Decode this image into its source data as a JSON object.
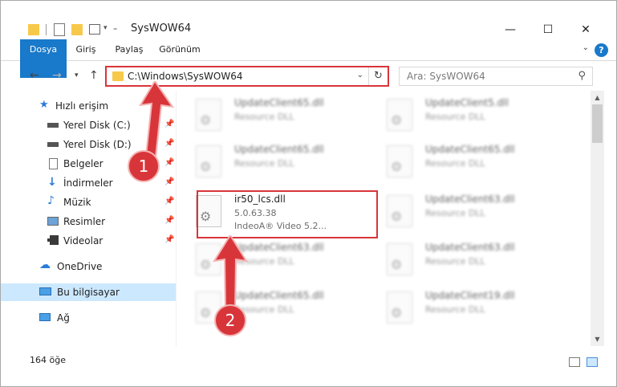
{
  "window": {
    "title": "SysWOW64",
    "controls": {
      "minimize": "—",
      "maximize": "☐",
      "close": "✕"
    }
  },
  "ribbon": {
    "tabs": [
      "Dosya",
      "Giriş",
      "Paylaş",
      "Görünüm"
    ],
    "help": "?"
  },
  "address": {
    "path": "C:\\Windows\\SysWOW64",
    "search_placeholder": "Ara: SysWOW64"
  },
  "sidebar": {
    "quick_access": "Hızlı erişim",
    "items": [
      {
        "label": "Yerel Disk (C:)",
        "icon": "drive-icon"
      },
      {
        "label": "Yerel Disk (D:)",
        "icon": "drive-icon"
      },
      {
        "label": "Belgeler",
        "icon": "documents-icon"
      },
      {
        "label": "İndirmeler",
        "icon": "downloads-icon"
      },
      {
        "label": "Müzik",
        "icon": "music-icon"
      },
      {
        "label": "Resimler",
        "icon": "pictures-icon"
      },
      {
        "label": "Videolar",
        "icon": "videos-icon"
      }
    ],
    "onedrive": "OneDrive",
    "this_pc": "Bu bilgisayar",
    "network": "Ağ"
  },
  "files": {
    "left_column": [
      {
        "name": "UpdateClient65.dll",
        "type": "Resource DLL",
        "blurred": true
      },
      {
        "name": "UpdateClient65.dll",
        "type": "Resource DLL",
        "blurred": true
      },
      {
        "name": "ir50_lcs.dll",
        "type": "5.0.63.38",
        "desc": "IndeoA® Video 5.2...",
        "blurred": false
      },
      {
        "name": "UpdateClient63.dll",
        "type": "Resource DLL",
        "blurred": true
      },
      {
        "name": "UpdateClient65.dll",
        "type": "Resource DLL",
        "blurred": true
      }
    ],
    "right_column": [
      {
        "name": "UpdateClient5.dll",
        "type": "Resource DLL"
      },
      {
        "name": "UpdateClient65.dll",
        "type": "Resource DLL"
      },
      {
        "name": "UpdateClient63.dll",
        "type": "Resource DLL"
      },
      {
        "name": "UpdateClient63.dll",
        "type": "Resource DLL"
      },
      {
        "name": "UpdateClient19.dll",
        "type": "Resource DLL"
      }
    ]
  },
  "status": {
    "item_count": "164 öğe"
  },
  "annotations": {
    "step1": "1",
    "step2": "2",
    "color": "#d8353a"
  }
}
